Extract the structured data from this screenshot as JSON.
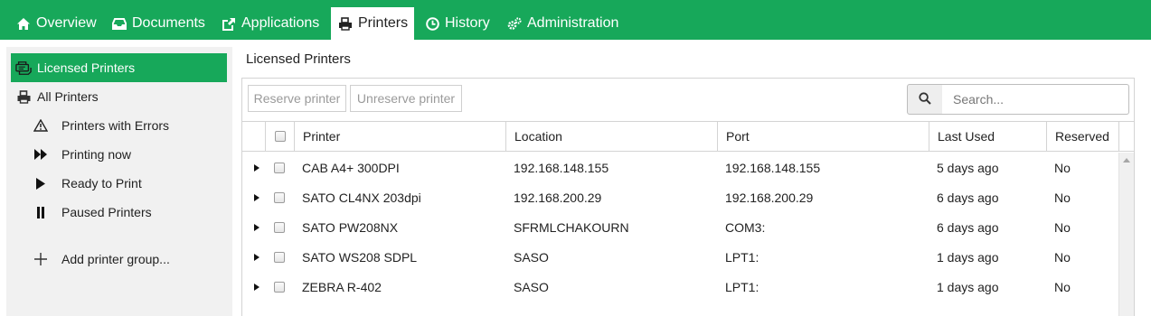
{
  "nav": {
    "tabs": [
      {
        "label": "Overview",
        "icon": "home-icon"
      },
      {
        "label": "Documents",
        "icon": "inbox-icon"
      },
      {
        "label": "Applications",
        "icon": "share-icon"
      },
      {
        "label": "Printers",
        "icon": "printer-icon",
        "active": true
      },
      {
        "label": "History",
        "icon": "clock-icon"
      },
      {
        "label": "Administration",
        "icon": "gears-icon"
      }
    ]
  },
  "sidebar": {
    "items": [
      {
        "label": "Licensed Printers",
        "icon": "licensed-printer-icon",
        "active": true
      },
      {
        "label": "All Printers",
        "icon": "printer-icon"
      },
      {
        "label": "Printers with Errors",
        "icon": "warning-icon"
      },
      {
        "label": "Printing now",
        "icon": "fast-forward-icon"
      },
      {
        "label": "Ready to Print",
        "icon": "play-icon"
      },
      {
        "label": "Paused Printers",
        "icon": "pause-icon"
      },
      {
        "label": "Add printer group...",
        "icon": "plus-icon"
      }
    ]
  },
  "main": {
    "title": "Licensed Printers",
    "toolbar": {
      "reserve_label": "Reserve printer",
      "unreserve_label": "Unreserve printer",
      "search_placeholder": "Search..."
    },
    "table": {
      "columns": [
        "Printer",
        "Location",
        "Port",
        "Last Used",
        "Reserved"
      ],
      "rows": [
        {
          "printer": "CAB A4+ 300DPI",
          "location": "192.168.148.155",
          "port": "192.168.148.155",
          "last_used": "5 days ago",
          "reserved": "No"
        },
        {
          "printer": "SATO CL4NX 203dpi",
          "location": "192.168.200.29",
          "port": "192.168.200.29",
          "last_used": "6 days ago",
          "reserved": "No"
        },
        {
          "printer": "SATO PW208NX",
          "location": "SFRMLCHAKOURN",
          "port": "COM3:",
          "last_used": "6 days ago",
          "reserved": "No"
        },
        {
          "printer": "SATO WS208 SDPL",
          "location": "SASO",
          "port": "LPT1:",
          "last_used": "1 days ago",
          "reserved": "No"
        },
        {
          "printer": "ZEBRA R-402",
          "location": "SASO",
          "port": "LPT1:",
          "last_used": "1 days ago",
          "reserved": "No"
        }
      ]
    }
  },
  "colors": {
    "accent": "#17a85a",
    "sidebar_bg": "#f1f1f1",
    "border": "#d4d4d4"
  }
}
